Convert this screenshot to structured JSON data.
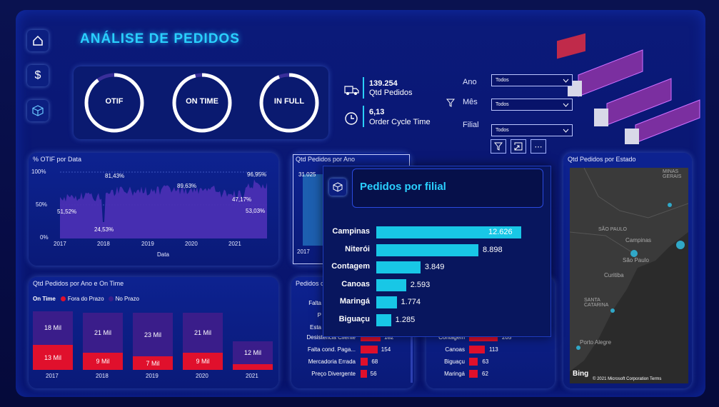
{
  "page_title": "ANÁLISE DE PEDIDOS",
  "nav": {
    "home": "home-icon",
    "money": "$",
    "cube": "cube-icon"
  },
  "gauges": [
    {
      "label": "OTIF",
      "level": 0.9
    },
    {
      "label": "ON TIME",
      "level": 0.96
    },
    {
      "label": "IN FULL",
      "level": 0.94
    }
  ],
  "kpis": [
    {
      "value": "139.254",
      "label": "Qtd Pedidos"
    },
    {
      "value": "6,13",
      "label": "Order Cycle Time"
    }
  ],
  "filters": [
    {
      "label": "Ano",
      "value": "Todos"
    },
    {
      "label": "Mês",
      "value": "Todos"
    },
    {
      "label": "Filial",
      "value": "Todos"
    }
  ],
  "otif": {
    "title": "% OTIF por Data",
    "y_ticks": [
      "100%",
      "50%",
      "0%"
    ],
    "x_ticks": [
      "2017",
      "2018",
      "2019",
      "2020",
      "2021"
    ],
    "xlabel": "Data",
    "annotations": [
      "81,43%",
      "51,52%",
      "24,53%",
      "89,63%",
      "47,17%",
      "96,95%",
      "53,03%"
    ]
  },
  "qpa": {
    "title": "Qtd Pedidos por Ano",
    "label": "31.025",
    "x": "2017"
  },
  "estado": {
    "title": "Qtd Pedidos por Estado",
    "map_labels": [
      "MINAS GERAIS",
      "SÃO PAULO",
      "Campinas",
      "São Paulo",
      "Curitiba",
      "SANTA CATARINA",
      "Porto Alegre"
    ],
    "bing": "Bing",
    "copyright": "© 2021 Microsoft Corporation  Terms"
  },
  "ontime": {
    "title": "Qtd Pedidos por Ano e On Time",
    "legend_title": "On Time",
    "legend": [
      "Fora do Prazo",
      "No Prazo"
    ],
    "colors": {
      "fora": "#e0102c",
      "no": "#3a1d8a"
    }
  },
  "motivo": {
    "title": "Pedidos co",
    "partial": [
      "Falta",
      "P",
      "Esta"
    ],
    "rows": [
      {
        "c": "Desistência Cliente",
        "v": "182",
        "w": 1
      },
      {
        "c": "Falta cond. Paga...",
        "v": "154",
        "w": 0.85
      },
      {
        "c": "Mercadoria Errada",
        "v": "68",
        "w": 0.37
      },
      {
        "c": "Preço Divergente",
        "v": "56",
        "w": 0.31
      }
    ]
  },
  "filial_small": {
    "rows": [
      {
        "c": "Contagem",
        "v": "205",
        "w": 1
      },
      {
        "c": "Canoas",
        "v": "113",
        "w": 0.55
      },
      {
        "c": "Biguaçu",
        "v": "63",
        "w": 0.31
      },
      {
        "c": "Maringá",
        "v": "62",
        "w": 0.3
      }
    ]
  },
  "popup": {
    "title": "Pedidos por filial"
  },
  "chart_data": [
    {
      "type": "bar",
      "title": "Pedidos por filial",
      "categories": [
        "Campinas",
        "Niterói",
        "Contagem",
        "Canoas",
        "Maringá",
        "Biguaçu"
      ],
      "values": [
        12626,
        8898,
        3849,
        2593,
        1774,
        1285
      ],
      "labels": [
        "12.626",
        "8.898",
        "3.849",
        "2.593",
        "1.774",
        "1.285"
      ]
    },
    {
      "type": "bar",
      "title": "Qtd Pedidos por Ano e On Time",
      "categories": [
        "2017",
        "2018",
        "2019",
        "2020",
        "2021"
      ],
      "series": [
        {
          "name": "Fora do Prazo",
          "values": [
            13,
            9,
            7,
            9,
            0
          ],
          "labels": [
            "13 Mil",
            "9 Mil",
            "7 Mil",
            "9 Mil",
            ""
          ]
        },
        {
          "name": "No Prazo",
          "values": [
            18,
            21,
            23,
            21,
            12
          ],
          "labels": [
            "18 Mil",
            "21 Mil",
            "23 Mil",
            "21 Mil",
            "12 Mil"
          ]
        }
      ]
    }
  ]
}
